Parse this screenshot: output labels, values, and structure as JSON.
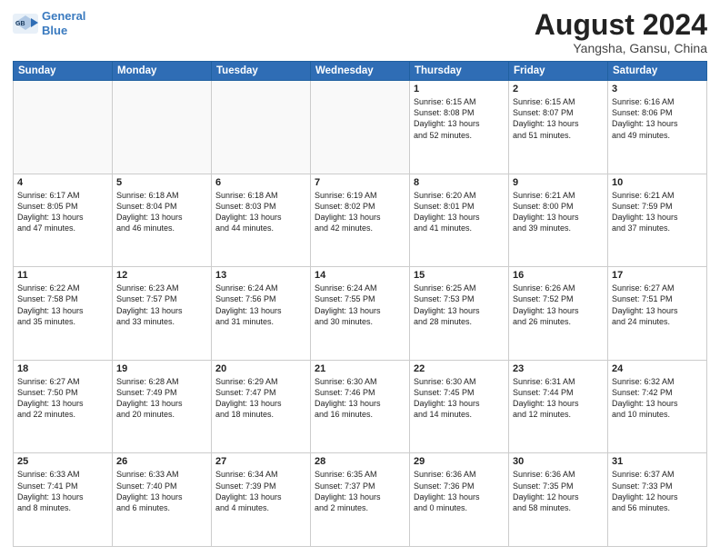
{
  "logo": {
    "line1": "General",
    "line2": "Blue"
  },
  "header": {
    "month_year": "August 2024",
    "location": "Yangsha, Gansu, China"
  },
  "weekdays": [
    "Sunday",
    "Monday",
    "Tuesday",
    "Wednesday",
    "Thursday",
    "Friday",
    "Saturday"
  ],
  "weeks": [
    [
      {
        "day": "",
        "text": "",
        "empty": true
      },
      {
        "day": "",
        "text": "",
        "empty": true
      },
      {
        "day": "",
        "text": "",
        "empty": true
      },
      {
        "day": "",
        "text": "",
        "empty": true
      },
      {
        "day": "1",
        "text": "Sunrise: 6:15 AM\nSunset: 8:08 PM\nDaylight: 13 hours\nand 52 minutes."
      },
      {
        "day": "2",
        "text": "Sunrise: 6:15 AM\nSunset: 8:07 PM\nDaylight: 13 hours\nand 51 minutes."
      },
      {
        "day": "3",
        "text": "Sunrise: 6:16 AM\nSunset: 8:06 PM\nDaylight: 13 hours\nand 49 minutes."
      }
    ],
    [
      {
        "day": "4",
        "text": "Sunrise: 6:17 AM\nSunset: 8:05 PM\nDaylight: 13 hours\nand 47 minutes."
      },
      {
        "day": "5",
        "text": "Sunrise: 6:18 AM\nSunset: 8:04 PM\nDaylight: 13 hours\nand 46 minutes."
      },
      {
        "day": "6",
        "text": "Sunrise: 6:18 AM\nSunset: 8:03 PM\nDaylight: 13 hours\nand 44 minutes."
      },
      {
        "day": "7",
        "text": "Sunrise: 6:19 AM\nSunset: 8:02 PM\nDaylight: 13 hours\nand 42 minutes."
      },
      {
        "day": "8",
        "text": "Sunrise: 6:20 AM\nSunset: 8:01 PM\nDaylight: 13 hours\nand 41 minutes."
      },
      {
        "day": "9",
        "text": "Sunrise: 6:21 AM\nSunset: 8:00 PM\nDaylight: 13 hours\nand 39 minutes."
      },
      {
        "day": "10",
        "text": "Sunrise: 6:21 AM\nSunset: 7:59 PM\nDaylight: 13 hours\nand 37 minutes."
      }
    ],
    [
      {
        "day": "11",
        "text": "Sunrise: 6:22 AM\nSunset: 7:58 PM\nDaylight: 13 hours\nand 35 minutes."
      },
      {
        "day": "12",
        "text": "Sunrise: 6:23 AM\nSunset: 7:57 PM\nDaylight: 13 hours\nand 33 minutes."
      },
      {
        "day": "13",
        "text": "Sunrise: 6:24 AM\nSunset: 7:56 PM\nDaylight: 13 hours\nand 31 minutes."
      },
      {
        "day": "14",
        "text": "Sunrise: 6:24 AM\nSunset: 7:55 PM\nDaylight: 13 hours\nand 30 minutes."
      },
      {
        "day": "15",
        "text": "Sunrise: 6:25 AM\nSunset: 7:53 PM\nDaylight: 13 hours\nand 28 minutes."
      },
      {
        "day": "16",
        "text": "Sunrise: 6:26 AM\nSunset: 7:52 PM\nDaylight: 13 hours\nand 26 minutes."
      },
      {
        "day": "17",
        "text": "Sunrise: 6:27 AM\nSunset: 7:51 PM\nDaylight: 13 hours\nand 24 minutes."
      }
    ],
    [
      {
        "day": "18",
        "text": "Sunrise: 6:27 AM\nSunset: 7:50 PM\nDaylight: 13 hours\nand 22 minutes."
      },
      {
        "day": "19",
        "text": "Sunrise: 6:28 AM\nSunset: 7:49 PM\nDaylight: 13 hours\nand 20 minutes."
      },
      {
        "day": "20",
        "text": "Sunrise: 6:29 AM\nSunset: 7:47 PM\nDaylight: 13 hours\nand 18 minutes."
      },
      {
        "day": "21",
        "text": "Sunrise: 6:30 AM\nSunset: 7:46 PM\nDaylight: 13 hours\nand 16 minutes."
      },
      {
        "day": "22",
        "text": "Sunrise: 6:30 AM\nSunset: 7:45 PM\nDaylight: 13 hours\nand 14 minutes."
      },
      {
        "day": "23",
        "text": "Sunrise: 6:31 AM\nSunset: 7:44 PM\nDaylight: 13 hours\nand 12 minutes."
      },
      {
        "day": "24",
        "text": "Sunrise: 6:32 AM\nSunset: 7:42 PM\nDaylight: 13 hours\nand 10 minutes."
      }
    ],
    [
      {
        "day": "25",
        "text": "Sunrise: 6:33 AM\nSunset: 7:41 PM\nDaylight: 13 hours\nand 8 minutes."
      },
      {
        "day": "26",
        "text": "Sunrise: 6:33 AM\nSunset: 7:40 PM\nDaylight: 13 hours\nand 6 minutes."
      },
      {
        "day": "27",
        "text": "Sunrise: 6:34 AM\nSunset: 7:39 PM\nDaylight: 13 hours\nand 4 minutes."
      },
      {
        "day": "28",
        "text": "Sunrise: 6:35 AM\nSunset: 7:37 PM\nDaylight: 13 hours\nand 2 minutes."
      },
      {
        "day": "29",
        "text": "Sunrise: 6:36 AM\nSunset: 7:36 PM\nDaylight: 13 hours\nand 0 minutes."
      },
      {
        "day": "30",
        "text": "Sunrise: 6:36 AM\nSunset: 7:35 PM\nDaylight: 12 hours\nand 58 minutes."
      },
      {
        "day": "31",
        "text": "Sunrise: 6:37 AM\nSunset: 7:33 PM\nDaylight: 12 hours\nand 56 minutes."
      }
    ]
  ]
}
